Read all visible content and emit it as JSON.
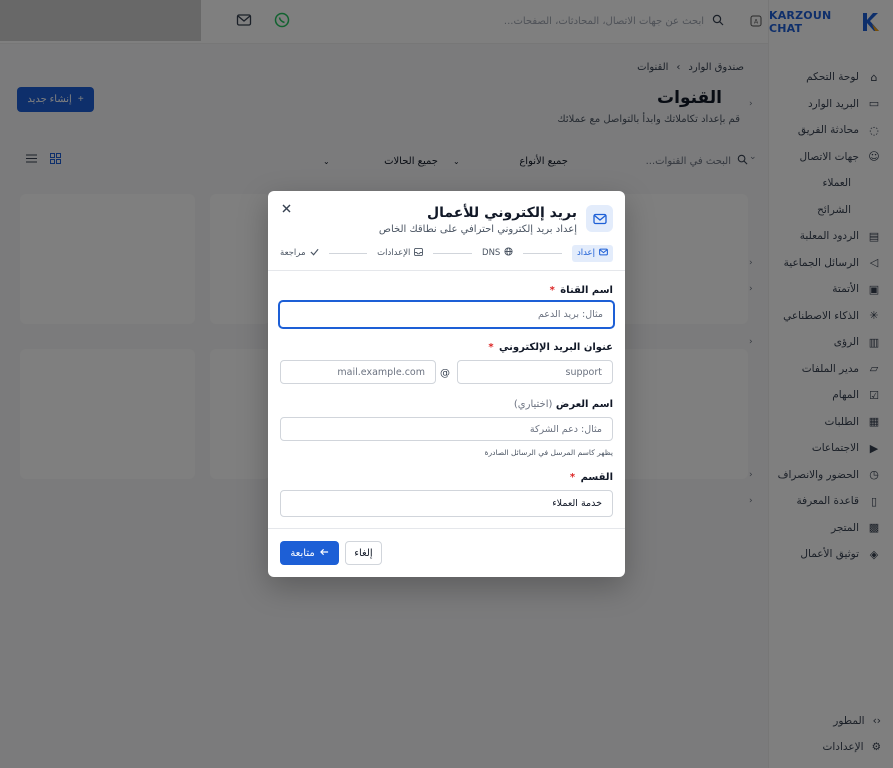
{
  "brand": {
    "name": "KARZOUN CHAT",
    "accent": "#1d5fd6"
  },
  "sidebar": {
    "items": [
      {
        "label": "لوحة التحكم",
        "icon": "home-icon"
      },
      {
        "label": "البريد الوارد",
        "icon": "inbox-icon"
      },
      {
        "label": "محادثة الفريق",
        "icon": "chat-icon"
      },
      {
        "label": "جهات الاتصال",
        "icon": "users-icon"
      },
      {
        "label": "العملاء",
        "icon": ""
      },
      {
        "label": "الشرائح",
        "icon": ""
      },
      {
        "label": "الردود المعلبة",
        "icon": "canned-icon"
      },
      {
        "label": "الرسائل الجماعية",
        "icon": "broadcast-icon"
      },
      {
        "label": "الأتمتة",
        "icon": "automation-icon"
      },
      {
        "label": "الذكاء الاصطناعي",
        "icon": "ai-icon"
      },
      {
        "label": "الرؤى",
        "icon": "chart-icon"
      },
      {
        "label": "مدير الملفات",
        "icon": "folder-icon"
      },
      {
        "label": "المهام",
        "icon": "task-icon"
      },
      {
        "label": "الطلبات",
        "icon": "orders-icon"
      },
      {
        "label": "الاجتماعات",
        "icon": "video-icon"
      },
      {
        "label": "الحضور والانصراف",
        "icon": "clock-icon"
      },
      {
        "label": "قاعدة المعرفة",
        "icon": "book-icon"
      },
      {
        "label": "المتجر",
        "icon": "store-icon"
      },
      {
        "label": "توثيق الأعمال",
        "icon": "shield-icon"
      }
    ],
    "bottom": [
      {
        "label": "المطور",
        "icon": "code-icon"
      },
      {
        "label": "الإعدادات",
        "icon": "gear-icon"
      }
    ]
  },
  "topbar": {
    "search_placeholder": "ابحث عن جهات الاتصال، المحادثات، الصفحات..."
  },
  "main": {
    "breadcrumb": [
      "صندوق الوارد",
      "القنوات"
    ],
    "title": "القنوات",
    "subtitle": "قم بإعداد تكاملاتك وابدأ بالتواصل مع عملائك",
    "create_label": "إنشاء جديد",
    "filters": {
      "search_placeholder": "البحث في القنوات...",
      "types": "جميع الأنواع",
      "statuses": "جميع الحالات"
    }
  },
  "modal": {
    "title": "بريد إلكتروني للأعمال",
    "subtitle": "إعداد بريد إلكتروني احترافي على نطاقك الخاص",
    "steps": [
      {
        "label": "إعداد",
        "icon": "mail-icon",
        "active": true
      },
      {
        "label": "DNS",
        "icon": "globe-icon",
        "active": false
      },
      {
        "label": "الإعدادات",
        "icon": "inbox-icon",
        "active": false
      },
      {
        "label": "مراجعة",
        "icon": "check-icon",
        "active": false
      }
    ],
    "fields": {
      "channel_name": {
        "label": "اسم القناة",
        "required": "*",
        "placeholder": "مثال: بريد الدعم"
      },
      "email": {
        "label": "عنوان البريد الإلكتروني",
        "required": "*",
        "local_placeholder": "support",
        "at": "@",
        "domain_placeholder": "mail.example.com"
      },
      "display_name": {
        "label": "اسم العرض",
        "optional": "(اختياري)",
        "placeholder": "مثال: دعم الشركة",
        "hint": "يظهر كاسم المرسل في الرسائل الصادرة"
      },
      "department": {
        "label": "القسم",
        "required": "*",
        "value": "خدمة العملاء"
      }
    },
    "buttons": {
      "next": "متابعة",
      "cancel": "إلغاء"
    }
  }
}
